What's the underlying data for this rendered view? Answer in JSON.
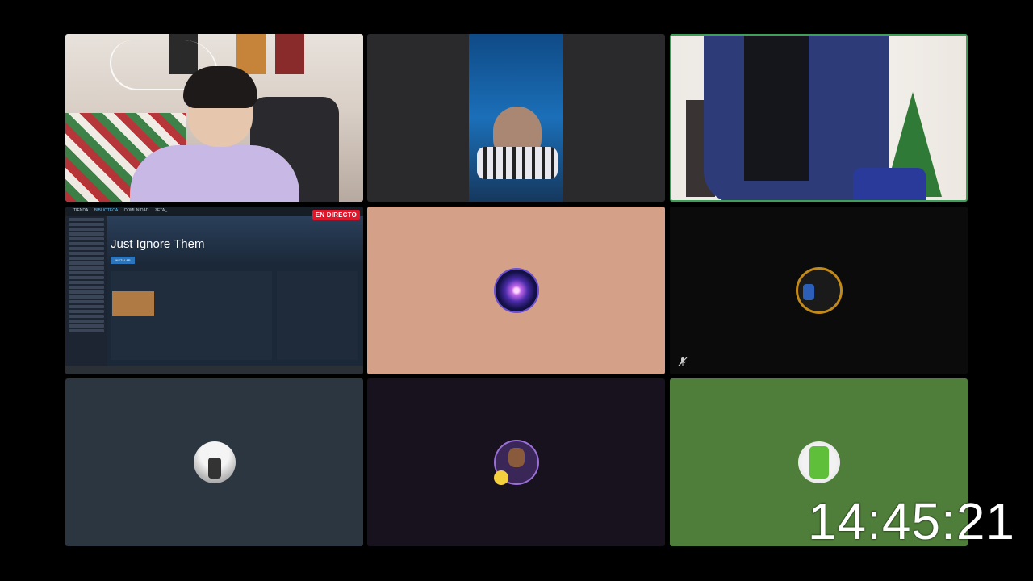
{
  "screen_share": {
    "game_title": "Just Ignore Them",
    "live_badge": "EN DIRECTO",
    "nav_tabs": [
      "TIENDA",
      "BIBLIOTECA",
      "COMUNIDAD",
      "ZETA_"
    ],
    "install_button": "INSTALAR"
  },
  "overlay": {
    "clock": "14:45:21"
  },
  "colors": {
    "active_speaker_border": "#3f9e5a",
    "live_badge": "#e0162b",
    "tile_peach": "#d4a088",
    "tile_green": "#4f7e3a",
    "tile_slate": "#2c3641",
    "tile_dark_purple": "#17121d"
  },
  "participants": [
    {
      "tile": 1,
      "type": "camera"
    },
    {
      "tile": 2,
      "type": "camera"
    },
    {
      "tile": 3,
      "type": "camera",
      "speaking": true
    },
    {
      "tile": 4,
      "type": "screen-share"
    },
    {
      "tile": 5,
      "type": "avatar",
      "icon": "galaxy-avatar"
    },
    {
      "tile": 6,
      "type": "avatar",
      "icon": "gold-chain-avatar",
      "muted": true
    },
    {
      "tile": 7,
      "type": "avatar",
      "icon": "snow-figure-avatar"
    },
    {
      "tile": 8,
      "type": "avatar",
      "icon": "pixel-portrait-avatar"
    },
    {
      "tile": 9,
      "type": "avatar",
      "icon": "green-can-avatar"
    }
  ]
}
